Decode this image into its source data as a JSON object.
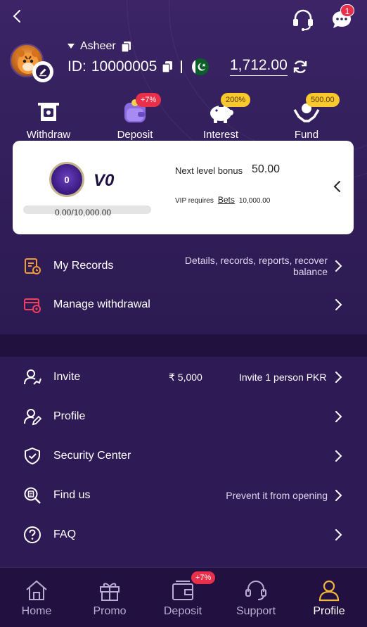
{
  "header": {
    "back_icon": "chevron-left-icon",
    "support_icon": "headset-icon",
    "chat_icon": "chat-icon",
    "chat_badge": "1"
  },
  "profile": {
    "username": "Asheer",
    "id_label": "ID:",
    "id_value": "10000005",
    "flag": "pakistan-flag",
    "balance": "1,712.00"
  },
  "quick_actions": [
    {
      "label": "Withdraw",
      "icon": "withdraw-icon",
      "badge": ""
    },
    {
      "label": "Deposit",
      "icon": "wallet-icon",
      "badge": "+7%"
    },
    {
      "label": "Interest",
      "icon": "piggy-bank-icon",
      "badge": "200%"
    },
    {
      "label": "Fund",
      "icon": "fund-hands-icon",
      "badge": "500.00"
    }
  ],
  "vip": {
    "medal_value": "0",
    "level": "V0",
    "progress_text": "0.00/10,000.00",
    "progress_fraction": 0,
    "next_level_label": "Next level bonus",
    "next_level_value": "50.00",
    "requires_label": "VIP requires",
    "requires_link": "Bets",
    "requires_value": "10,000.00"
  },
  "records_menu": [
    {
      "label": "My Records",
      "icon": "records-icon",
      "desc": "Details, records, reports, recover balance"
    },
    {
      "label": "Manage withdrawal",
      "icon": "card-gear-icon",
      "desc": ""
    }
  ],
  "settings_menu": [
    {
      "label": "Invite",
      "icon": "user-add-icon",
      "amount": "₹ 5,000",
      "desc": "Invite 1 person PKR"
    },
    {
      "label": "Profile",
      "icon": "user-edit-icon",
      "desc": ""
    },
    {
      "label": "Security Center",
      "icon": "shield-check-icon",
      "desc": ""
    },
    {
      "label": "Find us",
      "icon": "search-doc-icon",
      "desc": "Prevent it from opening"
    },
    {
      "label": "FAQ",
      "icon": "question-icon",
      "desc": ""
    }
  ],
  "tabbar": [
    {
      "label": "Home",
      "icon": "home-icon"
    },
    {
      "label": "Promo",
      "icon": "gift-icon"
    },
    {
      "label": "Deposit",
      "icon": "wallet-icon",
      "badge": "+7%"
    },
    {
      "label": "Support",
      "icon": "headset-icon"
    },
    {
      "label": "Profile",
      "icon": "user-icon",
      "active": true
    }
  ],
  "colors": {
    "accent_red": "#e8304a",
    "accent_yellow": "#f7c92c",
    "bg_purple": "#2e1a55"
  }
}
